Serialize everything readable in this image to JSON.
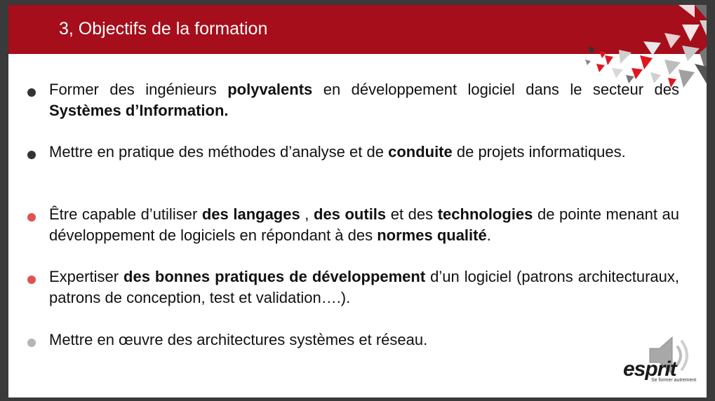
{
  "slide": {
    "title": "3, Objectifs de la formation"
  },
  "colors": {
    "title_band": "#a50e1a",
    "bullet_dark": "#333333",
    "bullet_red": "#e05252",
    "bullet_gray": "#b5b5b5"
  },
  "bullets": [
    {
      "segments": [
        {
          "t": "Former des ingénieurs ",
          "b": false
        },
        {
          "t": "polyvalents",
          "b": true
        },
        {
          "t": " en développement logiciel dans le secteur des ",
          "b": false
        },
        {
          "t": "Systèmes d’Information.",
          "b": true
        }
      ],
      "dot_color": "#333333"
    },
    {
      "segments": [
        {
          "t": "Mettre en pratique des méthodes d’analyse et de ",
          "b": false
        },
        {
          "t": "conduite",
          "b": true
        },
        {
          "t": " de projets informatiques.",
          "b": false
        }
      ],
      "dot_color": "#333333"
    },
    {
      "segments": [
        {
          "t": "Être capable d’utiliser  ",
          "b": false
        },
        {
          "t": "des langages",
          "b": true
        },
        {
          "t": " , ",
          "b": false
        },
        {
          "t": "des outils",
          "b": true
        },
        {
          "t": " et des ",
          "b": false
        },
        {
          "t": "technologies",
          "b": true
        },
        {
          "t": " de pointe menant au développement de logiciels en répondant  à des ",
          "b": false
        },
        {
          "t": "normes qualité",
          "b": true
        },
        {
          "t": ".",
          "b": false
        }
      ],
      "dot_color": "#e05252"
    },
    {
      "segments": [
        {
          "t": "Expertiser ",
          "b": false
        },
        {
          "t": "des bonnes pratiques de développement",
          "b": true
        },
        {
          "t": " d’un logiciel (patrons architecturaux, patrons de conception, test et validation….).",
          "b": false
        }
      ],
      "dot_color": "#e05252"
    },
    {
      "segments": [
        {
          "t": "Mettre en œuvre des architectures systèmes et réseau.",
          "b": false
        }
      ],
      "dot_color": "#b5b5b5"
    }
  ],
  "logo": {
    "text": "esprit",
    "tagline": "Se former autrement"
  },
  "icons": {
    "audio": "speaker-icon",
    "decoration": "triangle-pattern-icon"
  }
}
